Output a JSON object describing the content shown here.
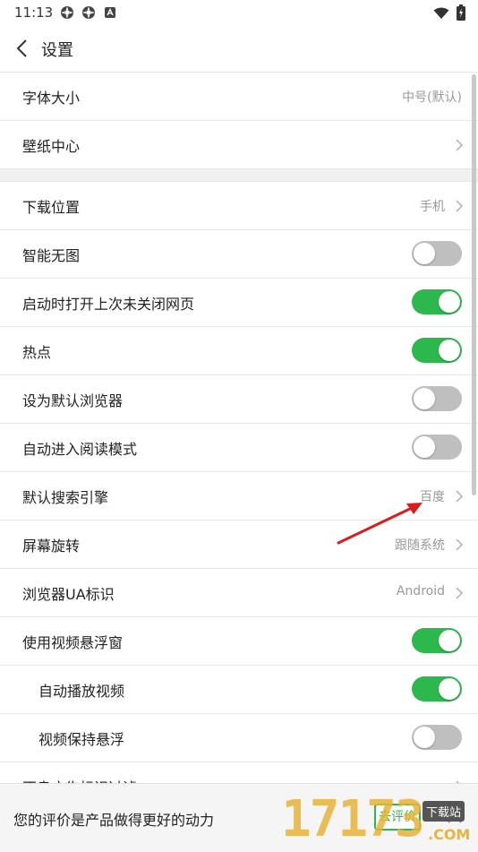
{
  "status_bar": {
    "time": "11:13"
  },
  "header": {
    "title": "设置"
  },
  "settings": {
    "font_size": {
      "label": "字体大小",
      "value": "中号(默认)"
    },
    "wallpaper": {
      "label": "壁纸中心"
    },
    "download_location": {
      "label": "下载位置",
      "value": "手机"
    },
    "smart_no_image": {
      "label": "智能无图",
      "state": "off"
    },
    "restore_tabs": {
      "label": "启动时打开上次未关闭网页",
      "state": "on"
    },
    "hot_spots": {
      "label": "热点",
      "state": "on"
    },
    "default_browser": {
      "label": "设为默认浏览器",
      "state": "off"
    },
    "reading_mode": {
      "label": "自动进入阅读模式",
      "state": "off"
    },
    "search_engine": {
      "label": "默认搜索引擎",
      "value": "百度"
    },
    "rotation": {
      "label": "屏幕旋转",
      "value": "跟随系统"
    },
    "ua": {
      "label": "浏览器UA标识",
      "value": "Android"
    },
    "video_float": {
      "label": "使用视频悬浮窗",
      "state": "on"
    },
    "autoplay": {
      "label": "自动播放视频",
      "state": "on"
    },
    "keep_float": {
      "label": "视频保持悬浮",
      "state": "off"
    },
    "ad_filter": {
      "label": "不良广告标识过滤"
    }
  },
  "bottom_bar": {
    "text": "您的评价是产品做得更好的动力",
    "button": "去评价"
  },
  "watermark": {
    "digits": "17173",
    "badge": "下载站",
    "suffix": ".COM"
  },
  "colors": {
    "toggle_on": "#2db84d",
    "toggle_off": "#bfbfbf",
    "annotation_arrow": "#d81e1e"
  }
}
